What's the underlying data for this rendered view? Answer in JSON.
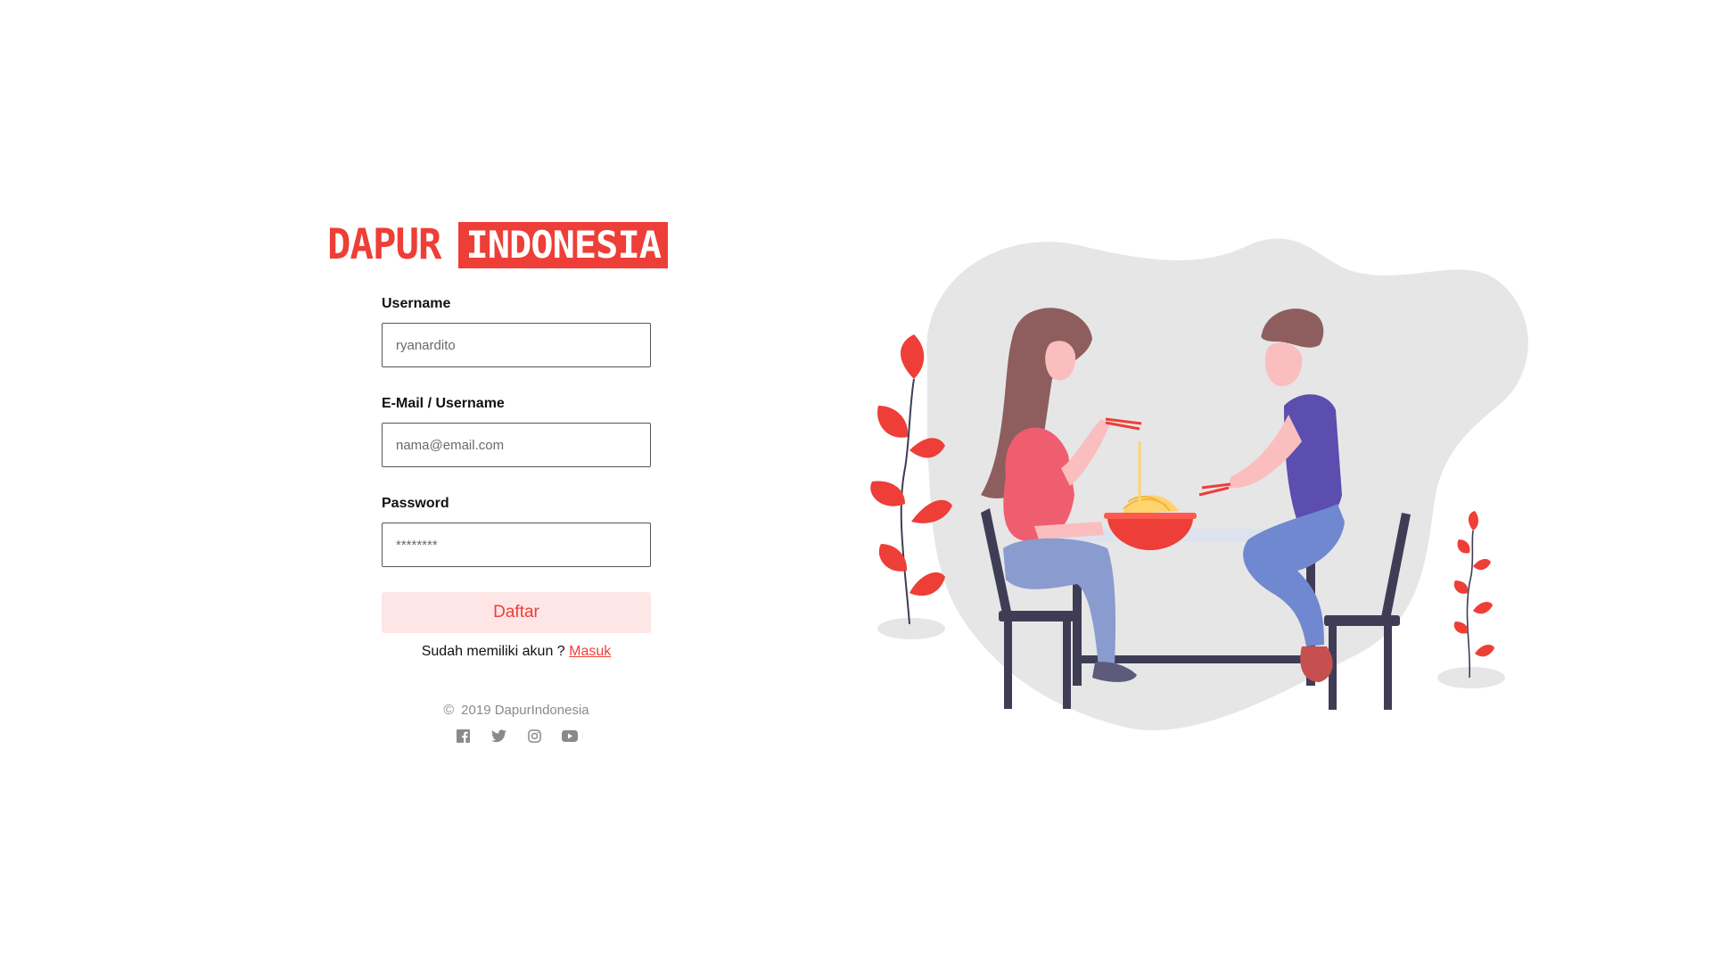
{
  "brand": {
    "word1": "DAPUR",
    "word2": "INDONESIA",
    "color": "#ee3e38"
  },
  "form": {
    "username": {
      "label": "Username",
      "placeholder": "ryanardito"
    },
    "email": {
      "label": "E-Mail / Username",
      "placeholder": "nama@email.com"
    },
    "password": {
      "label": "Password",
      "placeholder": "********"
    },
    "submit_label": "Daftar",
    "login_prompt": "Sudah memiliki akun ?",
    "login_link": "Masuk"
  },
  "footer": {
    "copyright_symbol": "©",
    "copyright_text": "2019 DapurIndonesia",
    "socials": [
      "facebook-icon",
      "twitter-icon",
      "instagram-icon",
      "youtube-icon"
    ]
  },
  "illustration": {
    "subject": "two-people-eating-noodles",
    "accent_color": "#ee3e38",
    "blob_color": "#e6e6e6"
  }
}
